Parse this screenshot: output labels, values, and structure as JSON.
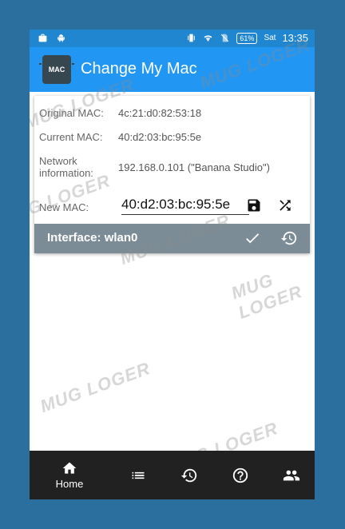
{
  "status_bar": {
    "battery": "61%",
    "day": "Sat",
    "time": "13:35"
  },
  "app_bar": {
    "logo_text": "MAC",
    "title": "Change My Mac"
  },
  "info": {
    "original_label": "Original MAC:",
    "original_value": "4c:21:d0:82:53:18",
    "current_label": "Current MAC:",
    "current_value": "40:d2:03:bc:95:5e",
    "network_label_line1": "Network",
    "network_label_line2": "information:",
    "network_value": "192.168.0.101 (\"Banana Studio\")",
    "new_label": "New MAC:",
    "new_value": "40:d2:03:bc:95:5e"
  },
  "interface_bar": {
    "label": "Interface: wlan0"
  },
  "bottom_nav": {
    "home_label": "Home"
  },
  "watermark": {
    "text": "MUG LOGER"
  },
  "colors": {
    "status_bar": "#1f86cf",
    "app_bar": "#2196f3",
    "interface_bar": "#7b8c96",
    "bottom_nav": "#212121",
    "frame": "#2a6f9e"
  },
  "icons": [
    "briefcase-icon",
    "android-icon",
    "vibrate-icon",
    "wifi-icon",
    "no-sim-icon",
    "battery-icon",
    "save-icon",
    "shuffle-icon",
    "check-icon",
    "restore-icon",
    "home-icon",
    "list-icon",
    "history-icon",
    "help-icon",
    "people-icon"
  ]
}
